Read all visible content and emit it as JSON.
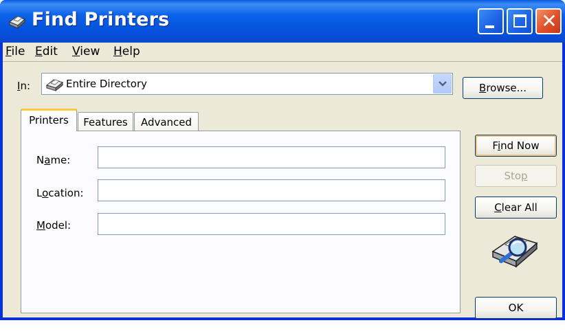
{
  "window": {
    "title": "Find Printers",
    "controls": {
      "minimize": "",
      "maximize": "",
      "close": "✕"
    }
  },
  "menu": {
    "file": {
      "accel": "F",
      "rest": "ile"
    },
    "edit": {
      "accel": "E",
      "rest": "dit"
    },
    "view": {
      "accel": "V",
      "rest": "iew"
    },
    "help": {
      "accel": "H",
      "rest": "elp"
    }
  },
  "in_field": {
    "label_accel": "I",
    "label_rest": "n:",
    "value": "Entire Directory",
    "icon": "printer-icon"
  },
  "buttons": {
    "browse": {
      "accel": "B",
      "rest": "rowse..."
    },
    "find_now": {
      "pre": "F",
      "accel": "i",
      "rest": "nd Now"
    },
    "stop": {
      "pre": "Sto",
      "accel": "p",
      "rest": ""
    },
    "clear_all": {
      "accel": "C",
      "rest": "lear All"
    },
    "ok": "OK"
  },
  "tabs": [
    {
      "label": "Printers",
      "selected": true
    },
    {
      "label": "Features",
      "selected": false
    },
    {
      "label": "Advanced",
      "selected": false
    }
  ],
  "fields": {
    "name": {
      "pre": "N",
      "accel": "a",
      "rest": "me:",
      "value": ""
    },
    "location": {
      "pre": "L",
      "accel": "o",
      "rest": "cation:",
      "value": ""
    },
    "model": {
      "pre": "",
      "accel": "M",
      "rest": "odel:",
      "value": ""
    }
  },
  "colors": {
    "titlebar": "#0552dd",
    "face": "#ece9d8",
    "accent_tab": "#ffc83c",
    "default_button_glow": "#f1c277",
    "close_button": "#e0542b"
  },
  "icons": [
    "printer-search-icon",
    "printer-icon",
    "chevron-down-icon",
    "magnifier-printer-icon"
  ]
}
